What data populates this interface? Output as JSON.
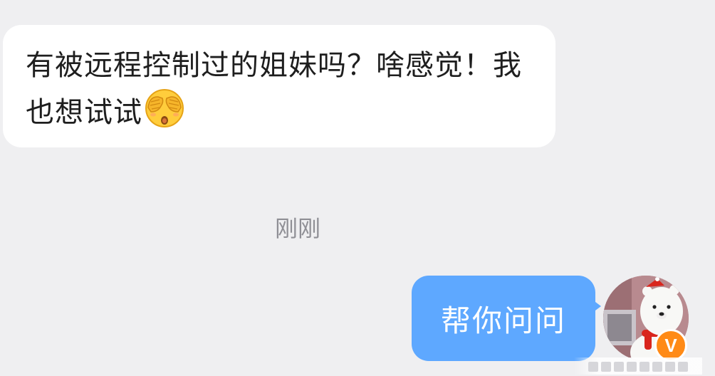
{
  "messages": {
    "incoming": {
      "text": "有被远程控制过的姐妹吗？啥感觉！我也想试试",
      "emoji": "face-with-hands-over-eyes-icon"
    },
    "timestamp": "刚刚",
    "outgoing": {
      "text": "帮你问问"
    }
  },
  "avatar": {
    "badge_text": "V",
    "badge_color": "#ff8a16"
  },
  "colors": {
    "background": "#efeff1",
    "incoming_bubble": "#ffffff",
    "outgoing_bubble": "#5ea8ff",
    "timestamp": "#8f8f95"
  }
}
